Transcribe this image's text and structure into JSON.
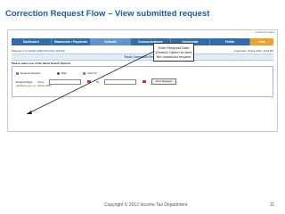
{
  "slide": {
    "title": "Correction Request Flow – View submitted request",
    "footer": "Copyright © 2012 Income Tax Department",
    "page_number": "11"
  },
  "screenshot": {
    "top_links": "Contact Us  Logout",
    "nav": [
      {
        "label": "Dashboard"
      },
      {
        "label": "Statements / Payments"
      },
      {
        "label": "Defaults"
      },
      {
        "label": "Communications"
      },
      {
        "label": "Downloads"
      },
      {
        "label": "Profile"
      },
      {
        "label": "Help"
      }
    ],
    "welcome_prefix": "Welcome",
    "welcome_company": "XYZ DEVELOPER PRIVATE LIMITED",
    "login_info": "Login Date: 25 Sep 2012, 11:42 PM",
    "page_heading": "Track Correction Request",
    "instruction": "Please select one of the below Search Options",
    "radios": [
      {
        "label": "Request Number",
        "selected": false
      },
      {
        "label": "Date",
        "selected": true
      },
      {
        "label": "View All",
        "selected": false
      }
    ],
    "date_label": "Request Date",
    "from_label": "From",
    "to_label": "To",
    "view_button": "View Request",
    "hint": "(dd-Mmm-yyyy, e.g., 25-Jan-1995)",
    "callout": "Enter Request Date (Search Option to view the download request"
  },
  "colors": {
    "title": "#1f5aa0",
    "nav_bg": "#2f6ca8",
    "nav_active": "#5e95cf",
    "help_bg": "#f0a12a"
  }
}
